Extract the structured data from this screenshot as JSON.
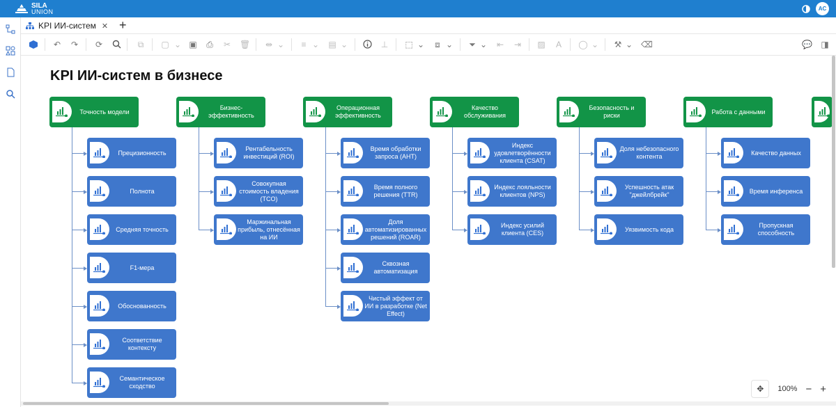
{
  "app": {
    "logo_line1": "SILA",
    "logo_line2": "UNION",
    "avatar": "AC"
  },
  "tab": {
    "label": "KPI ИИ-систем",
    "close": "✕",
    "add": "+"
  },
  "toolbar": {
    "icons": [
      "cube-icon",
      "undo-icon",
      "redo-icon",
      "refresh-icon",
      "search-icon",
      "copy-icon",
      "paste-icon",
      "layout-icon",
      "print-icon",
      "cut-icon",
      "delete-icon",
      "align-icon",
      "format-icon",
      "arrange-icon",
      "info-icon",
      "hierarchy-icon",
      "select-icon",
      "group-icon",
      "filter-icon",
      "move-left-icon",
      "move-right-icon",
      "image-icon",
      "text-icon",
      "shape-icon",
      "paint-icon",
      "eraser-icon",
      "comment-icon",
      "panel-icon"
    ]
  },
  "diagram": {
    "title": "KPI ИИ-систем в бизнесе",
    "categories": [
      {
        "label": "Точность модели",
        "items": [
          "Прецизионность",
          "Полнота",
          "Средняя точность",
          "F1-мера",
          "Обоснованность",
          "Соответствие контексту",
          "Семантическое сходство"
        ]
      },
      {
        "label": "Бизнес-эффективность",
        "items": [
          "Рентабельность инвестиций (ROI)",
          "Совокупная стоимость владения (TCO)",
          "Маржинальная прибыль, отнесённая на ИИ"
        ]
      },
      {
        "label": "Операционная эффективность",
        "items": [
          "Время обработки запроса (AHT)",
          "Время полного решения (TTR)",
          "Доля автоматизированных решений (ROAR)",
          "Сквозная автоматизация",
          "Чистый эффект от ИИ в разработке (Net Effect)"
        ]
      },
      {
        "label": "Качество обслуживания",
        "items": [
          "Индекс удовлетворённости клиента (CSAT)",
          "Индекс лояльности клиентов (NPS)",
          "Индекс усилий клиента (CES)"
        ]
      },
      {
        "label": "Безопасность и риски",
        "items": [
          "Доля небезопасного контента",
          "Успешность атак \"джейлбрейк\"",
          "Уязвимость кода"
        ]
      },
      {
        "label": "Работа с данными",
        "items": [
          "Качество данных",
          "Время инференса",
          "Пропускная способность"
        ]
      }
    ]
  },
  "zoom": {
    "level": "100%",
    "minus": "−",
    "plus": "+"
  },
  "colors": {
    "topbar": "#1f7fcf",
    "category": "#129447",
    "metric": "#3f77cc",
    "connector": "#6b8fc7"
  }
}
